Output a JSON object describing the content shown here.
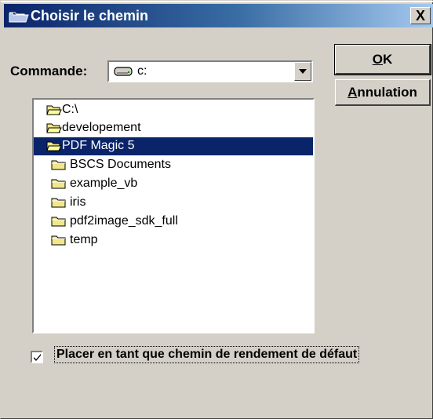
{
  "window": {
    "title": "Choisir le chemin",
    "close_label": "X"
  },
  "command": {
    "label": "Commande:",
    "drive_value": "c:"
  },
  "buttons": {
    "ok_underline": "O",
    "ok_rest": "K",
    "cancel_underline": "A",
    "cancel_rest": "nnulation"
  },
  "folders": [
    {
      "label": "C:\\",
      "open": true,
      "selected": false
    },
    {
      "label": "developement",
      "open": true,
      "selected": false
    },
    {
      "label": "PDF Magic 5",
      "open": true,
      "selected": true
    },
    {
      "label": "BSCS Documents",
      "open": false,
      "selected": false
    },
    {
      "label": "example_vb",
      "open": false,
      "selected": false
    },
    {
      "label": "iris",
      "open": false,
      "selected": false
    },
    {
      "label": "pdf2image_sdk_full",
      "open": false,
      "selected": false
    },
    {
      "label": "temp",
      "open": false,
      "selected": false
    }
  ],
  "checkbox": {
    "label": "Placer en tant que chemin de rendement de défaut",
    "checked": true
  }
}
